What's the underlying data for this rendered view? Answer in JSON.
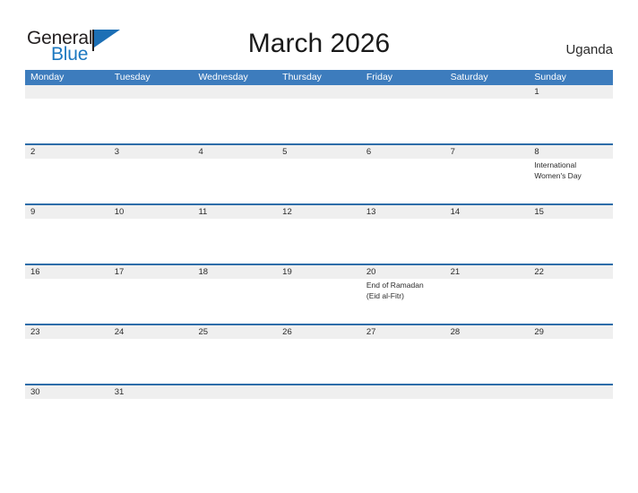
{
  "brand": {
    "name_part1": "General",
    "name_part2": "Blue",
    "flag_icon": "blue-flag-icon"
  },
  "header": {
    "title": "March 2026",
    "country": "Uganda"
  },
  "colors": {
    "header_blue": "#3d7cbd",
    "row_divider_blue": "#2e6da9",
    "day_strip_gray": "#efefef",
    "brand_blue": "#1c78c0",
    "text_dark": "#2b2b2b"
  },
  "calendar": {
    "day_headers": [
      "Monday",
      "Tuesday",
      "Wednesday",
      "Thursday",
      "Friday",
      "Saturday",
      "Sunday"
    ],
    "weeks": [
      [
        {
          "num": "",
          "events": []
        },
        {
          "num": "",
          "events": []
        },
        {
          "num": "",
          "events": []
        },
        {
          "num": "",
          "events": []
        },
        {
          "num": "",
          "events": []
        },
        {
          "num": "",
          "events": []
        },
        {
          "num": "1",
          "events": []
        }
      ],
      [
        {
          "num": "2",
          "events": []
        },
        {
          "num": "3",
          "events": []
        },
        {
          "num": "4",
          "events": []
        },
        {
          "num": "5",
          "events": []
        },
        {
          "num": "6",
          "events": []
        },
        {
          "num": "7",
          "events": []
        },
        {
          "num": "8",
          "events": [
            "International",
            "Women's Day"
          ]
        }
      ],
      [
        {
          "num": "9",
          "events": []
        },
        {
          "num": "10",
          "events": []
        },
        {
          "num": "11",
          "events": []
        },
        {
          "num": "12",
          "events": []
        },
        {
          "num": "13",
          "events": []
        },
        {
          "num": "14",
          "events": []
        },
        {
          "num": "15",
          "events": []
        }
      ],
      [
        {
          "num": "16",
          "events": []
        },
        {
          "num": "17",
          "events": []
        },
        {
          "num": "18",
          "events": []
        },
        {
          "num": "19",
          "events": []
        },
        {
          "num": "20",
          "events": [
            "End of Ramadan",
            "(Eid al-Fitr)"
          ]
        },
        {
          "num": "21",
          "events": []
        },
        {
          "num": "22",
          "events": []
        }
      ],
      [
        {
          "num": "23",
          "events": []
        },
        {
          "num": "24",
          "events": []
        },
        {
          "num": "25",
          "events": []
        },
        {
          "num": "26",
          "events": []
        },
        {
          "num": "27",
          "events": []
        },
        {
          "num": "28",
          "events": []
        },
        {
          "num": "29",
          "events": []
        }
      ],
      [
        {
          "num": "30",
          "events": []
        },
        {
          "num": "31",
          "events": []
        },
        {
          "num": "",
          "events": []
        },
        {
          "num": "",
          "events": []
        },
        {
          "num": "",
          "events": []
        },
        {
          "num": "",
          "events": []
        },
        {
          "num": "",
          "events": []
        }
      ]
    ]
  }
}
